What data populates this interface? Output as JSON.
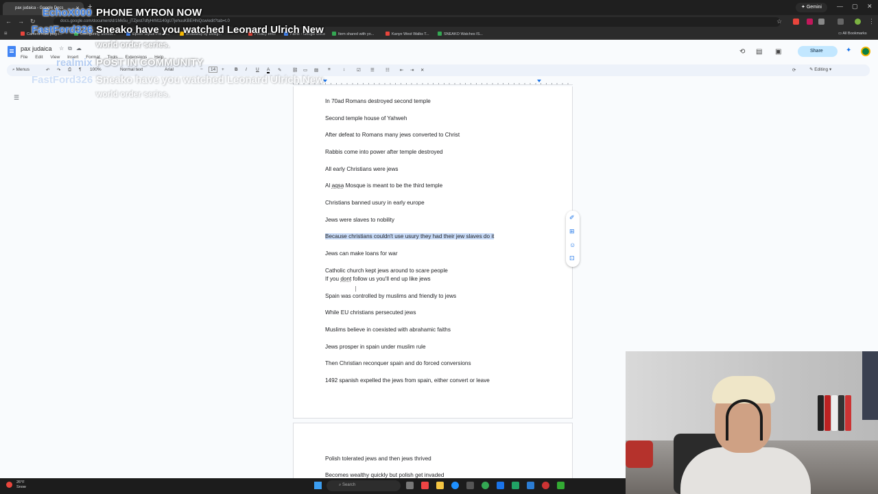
{
  "browser": {
    "tab_title": "pax judaica - Google Docs",
    "url": "docs.google.com/document/d/1Mk5u_jTZjest7dfyHrM1140gU7jehuuKBEHhiQcw/edit?tab=t.0",
    "gemini_label": "Gemini",
    "all_bookmarks": "All Bookmarks",
    "bookmarks": [
      {
        "label": "Camera Raw plug-i...",
        "color": "#e8453c"
      },
      {
        "label": "Configuring Sonicw...",
        "color": "#34a853"
      },
      {
        "label": "Epson Stylus Pro 38...",
        "color": "#4285f4"
      },
      {
        "label": "Broadway by Desig...",
        "color": "#fbbc04"
      },
      {
        "label": "Privacy error",
        "color": "#e8453c"
      },
      {
        "label": "Fame - Google Docs",
        "color": "#4285f4"
      },
      {
        "label": "Item shared with yo...",
        "color": "#34a853"
      },
      {
        "label": "Kanye West Walks T...",
        "color": "#e8453c"
      },
      {
        "label": "SNEAKO Watches IS...",
        "color": "#34a853"
      }
    ]
  },
  "docs": {
    "title": "pax judaica",
    "menu": [
      "File",
      "Edit",
      "View",
      "Insert",
      "Format",
      "Tools",
      "Extensions",
      "Help"
    ],
    "share_label": "Share",
    "toolbar": {
      "menus": "Menus",
      "zoom": "100%",
      "style": "Normal text",
      "font": "Arial",
      "font_size": "14",
      "bold": "B",
      "italic": "I",
      "underline": "U",
      "text_color": "A",
      "mode": "Editing"
    }
  },
  "document": {
    "page1": [
      "In 70ad Romans destroyed second temple",
      "Second temple house of Yahweh",
      "After defeat to Romans many jews converted to Christ",
      "Rabbis come into power after temple destroyed",
      "All early Christians were jews",
      "Christians banned usury in early europe",
      "Jews were slaves to nobility",
      "Because christians couldn't use usury they had their jew slaves do it",
      "Jews can make loans for war",
      "Catholic church kept jews around to scare people",
      "Spain was controlled by muslims and friendly to jews",
      "While EU christians persecuted jews",
      "Muslims believe in coexisted with abrahamic faiths",
      "Jews prosper in spain under muslim rule",
      "Then Christian reconquer spain and do forced conversions",
      "1492 spanish expelled the jews from spain, either convert or leave"
    ],
    "alaqsa": {
      "pre": "Al ",
      "squiggle": "aqsa",
      "post": " Mosque is meant to be the third temple"
    },
    "dont_line": {
      "pre": "If you ",
      "squiggle": "dont",
      "post": " follow us you'll end up like jews"
    },
    "page2": [
      "Polish tolerated jews and then jews thrived",
      "Becomes wealthy quickly but polish get invaded"
    ]
  },
  "overlays": {
    "user1": "EchoX000",
    "msg1": "PHONE MYRON NOW",
    "user2": "FastFord326",
    "msg2": "Sneako have you watched Leonard Ulrich New",
    "msg2b": "world order series.",
    "user3": "realmix",
    "msg3": "POST IN COMMUNITY",
    "user4": "FastFord326",
    "msg4": "Sneako have you watched Leonard Ulrich New",
    "msg4b": "world order series."
  },
  "taskbar": {
    "temp": "26°F",
    "weather": "Snow",
    "search_placeholder": "Search"
  }
}
